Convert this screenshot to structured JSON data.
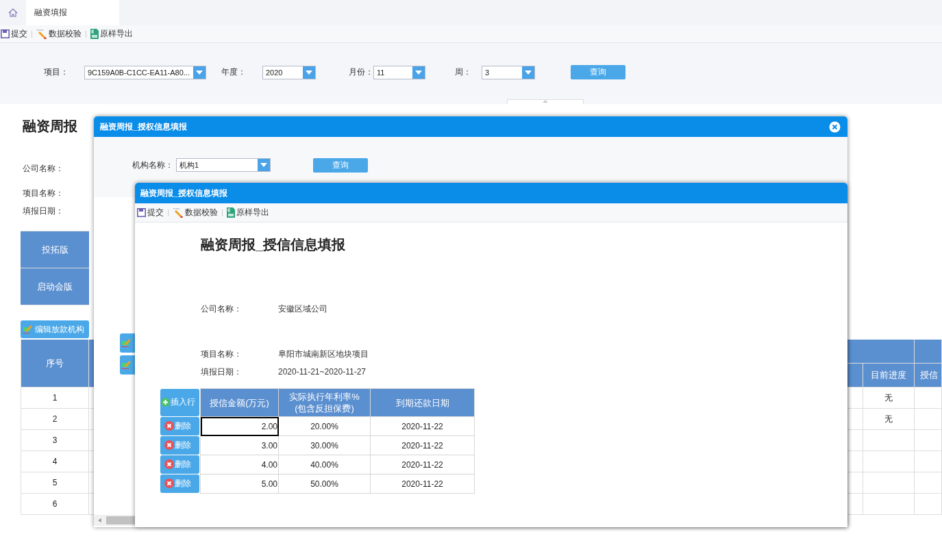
{
  "tabs": [
    {
      "kind": "home",
      "selected": false
    },
    {
      "kind": "text",
      "label": "融资填报",
      "selected": true
    }
  ],
  "toolbar": [
    {
      "kind": "save",
      "label": "提交"
    },
    {
      "kind": "check",
      "label": "数据校验"
    },
    {
      "kind": "export",
      "label": "原样导出"
    }
  ],
  "filters": [
    {
      "label": "项目：",
      "value": "9C159A0B-C1CC-EA11-A80..."
    },
    {
      "label": "年度：",
      "value": "2020"
    },
    {
      "label": "月份：",
      "value": "11"
    },
    {
      "label": "周：",
      "value": "3"
    }
  ],
  "query_button": "查询",
  "report": {
    "title": "融资周报",
    "field_labels": [
      "公司名称：",
      "项目名称：",
      "填报日期："
    ],
    "versions": [
      "投拓版",
      "启动会版"
    ],
    "edit_button": "编辑放款机构",
    "table": {
      "columns": [
        "序号",
        "目前进度",
        "授信"
      ],
      "rows": [
        {
          "index": "1",
          "progress": "无"
        },
        {
          "index": "2",
          "progress": "无"
        },
        {
          "index": "3"
        },
        {
          "index": "4"
        },
        {
          "index": "5"
        },
        {
          "index": "6"
        }
      ]
    }
  },
  "outer_dialog": {
    "title": "融资周报_授权信息填报",
    "filter_label": "机构名称：",
    "filter_value": "机构1",
    "query_button": "查询"
  },
  "inner_dialog": {
    "title": "融资周报_授权信息填报",
    "toolbar": [
      {
        "kind": "save",
        "label": "提交"
      },
      {
        "kind": "check",
        "label": "数据校验"
      },
      {
        "kind": "export",
        "label": "原样导出"
      }
    ],
    "heading": "融资周报_授信信息填报",
    "fields": [
      {
        "label": "公司名称：",
        "value": "安徽区域公司"
      },
      {
        "label": "项目名称：",
        "value": "阜阳市城南新区地块项目"
      },
      {
        "label": "填报日期：",
        "value": "2020-11-21~2020-11-27"
      }
    ],
    "insert_button": "插入行",
    "columns": [
      "授信金额(万元)",
      "实际执行年利率%\n(包含反担保费)",
      "到期还款日期"
    ],
    "rows": [
      {
        "delete_button": "删除",
        "amount": "2.00",
        "rate": "20.00%",
        "due": "2020-11-22",
        "selected": true
      },
      {
        "delete_button": "删除",
        "amount": "3.00",
        "rate": "30.00%",
        "due": "2020-11-22",
        "selected": false
      },
      {
        "delete_button": "删除",
        "amount": "4.00",
        "rate": "40.00%",
        "due": "2020-11-22",
        "selected": false
      },
      {
        "delete_button": "删除",
        "amount": "5.00",
        "rate": "50.00%",
        "due": "2020-11-22",
        "selected": false
      }
    ]
  }
}
